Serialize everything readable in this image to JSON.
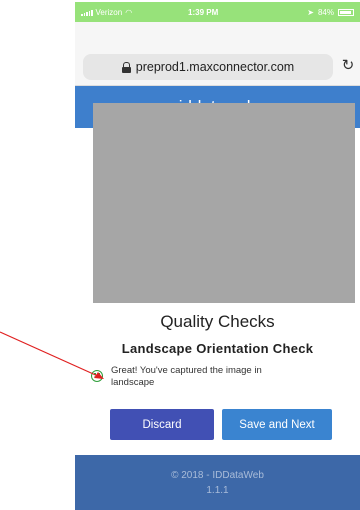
{
  "status_bar": {
    "carrier": "Verizon",
    "time": "1:39 PM",
    "battery": "84%"
  },
  "browser": {
    "url": "preprod1.maxconnector.com"
  },
  "header": {
    "title": "iddataweb"
  },
  "content": {
    "title": "Quality Checks",
    "subtitle": "Landscape Orientation Check",
    "check_message": "Great! You've captured the image in landscape"
  },
  "buttons": {
    "discard": "Discard",
    "save_next": "Save and Next"
  },
  "footer": {
    "copyright": "© 2018 - IDDataWeb",
    "version": "1.1.1"
  },
  "colors": {
    "header": "#3e7fcc",
    "discard_button": "#4150b4",
    "save_button": "#3a84d0",
    "footer": "#3d68a8",
    "status_bar": "#97e27a",
    "annotation_arrow": "#e02020",
    "success_icon": "#2e9e3a"
  },
  "icons": [
    "signal-icon",
    "wifi-icon",
    "location-icon",
    "battery-icon",
    "lock-icon",
    "reload-icon",
    "smile-icon"
  ]
}
